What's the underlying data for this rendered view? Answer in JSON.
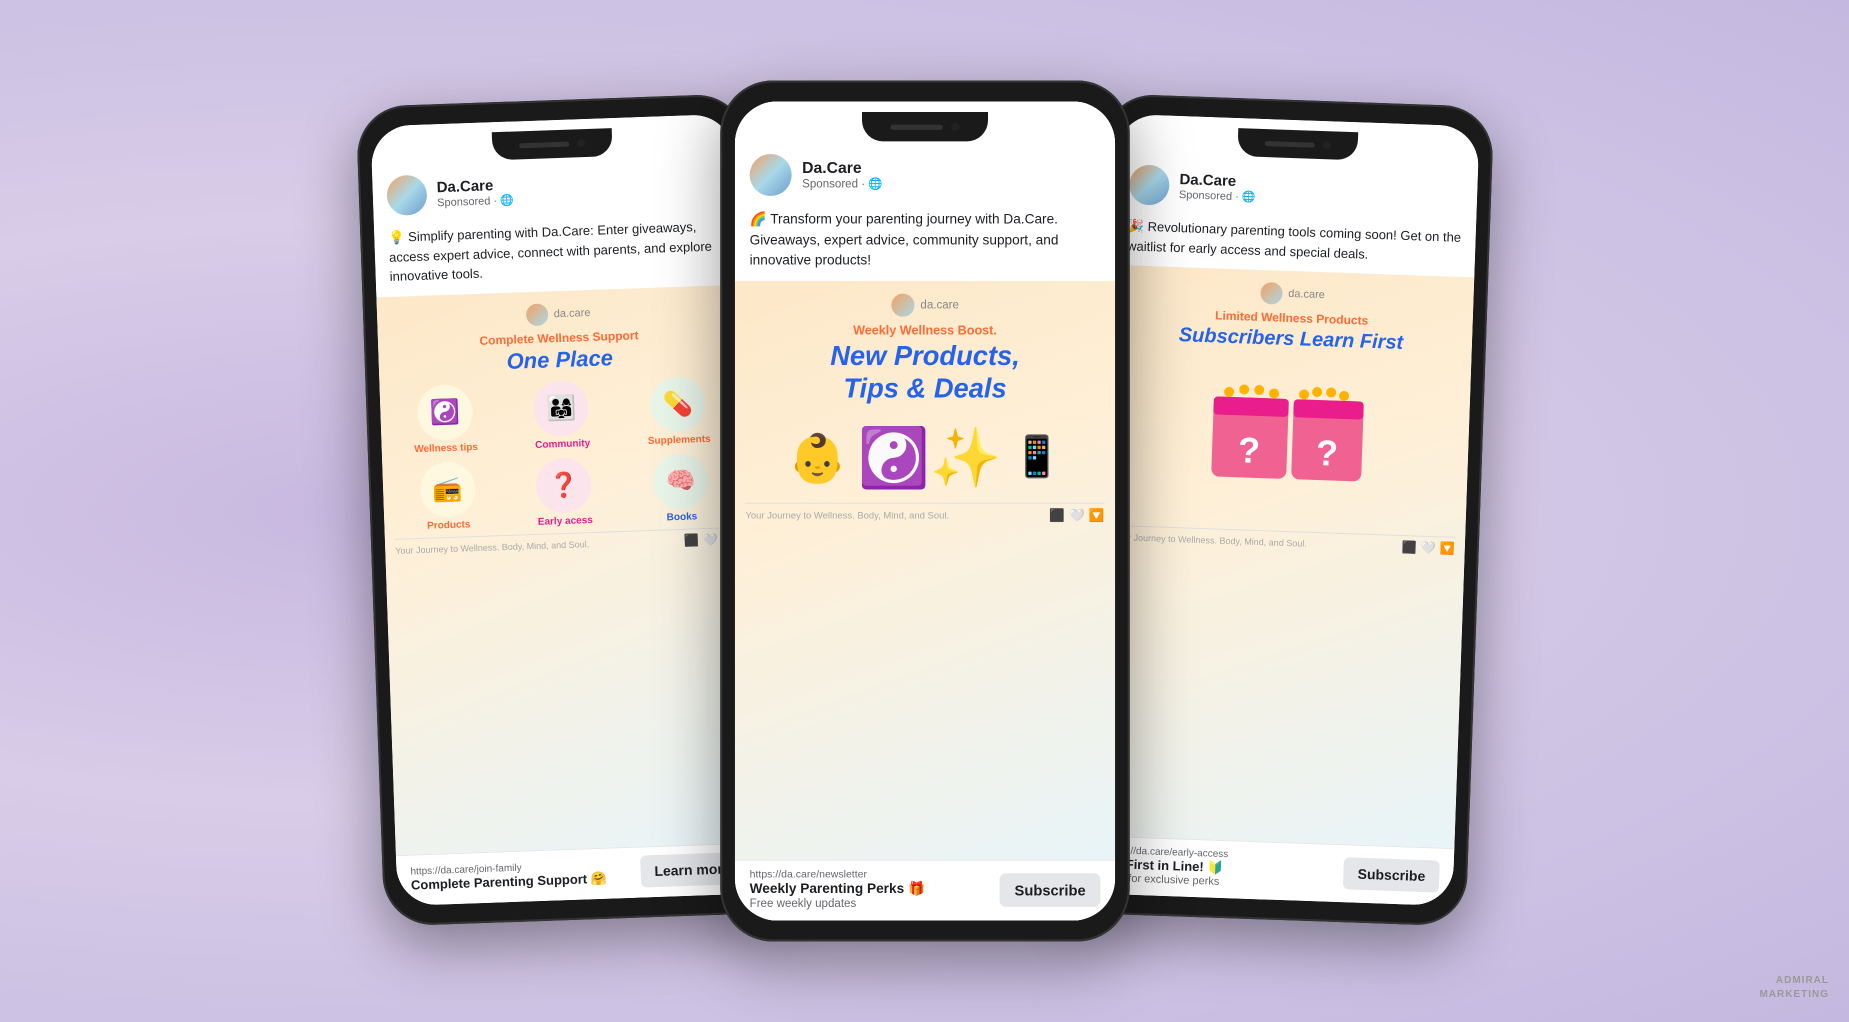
{
  "phones": [
    {
      "id": "left",
      "brand": "Da.Care",
      "sponsored": "Sponsored · 🌐",
      "ad_text": "💡 Simplify parenting with Da.Care: Enter giveaways, access expert advice, connect with parents, and explore innovative tools.",
      "creative": {
        "logo_text": "da.care",
        "subtitle": "Complete Wellness Support",
        "title": "One Place",
        "icons": [
          {
            "emoji": "☯️",
            "label": "Wellness tips",
            "color": "orange"
          },
          {
            "emoji": "👨‍👩‍👧",
            "label": "Community",
            "color": "pink"
          },
          {
            "emoji": "💊",
            "label": "Supplements",
            "color": "green"
          },
          {
            "emoji": "📻",
            "label": "Products",
            "color": "orange"
          },
          {
            "emoji": "❓",
            "label": "Early acess",
            "color": "pink"
          },
          {
            "emoji": "🧠",
            "label": "Books",
            "color": "blue"
          }
        ],
        "footer_text": "Your Journey to Wellness. Body, Mind, and Soul."
      },
      "cta": {
        "url": "https://da.care/join-family",
        "title": "Complete Parenting Support 🤗",
        "subtitle": "",
        "button": "Learn more"
      }
    },
    {
      "id": "center",
      "brand": "Da.Care",
      "sponsored": "Sponsored · 🌐",
      "ad_text": "🌈 Transform your parenting journey with Da.Care. Giveaways, expert advice, community support, and innovative products!",
      "creative": {
        "logo_text": "da.care",
        "subtitle": "Weekly Wellness Boost.",
        "title": "New Products,\nTips & Deals",
        "icons_type": "row",
        "icons": [
          {
            "emoji": "👶",
            "label": ""
          },
          {
            "emoji": "☯️✨",
            "label": ""
          },
          {
            "emoji": "📱",
            "label": ""
          }
        ],
        "footer_text": "Your Journey to Wellness. Body, Mind, and Soul."
      },
      "cta": {
        "url": "https://da.care/newsletter",
        "title": "Weekly Parenting Perks 🎁",
        "subtitle": "Free weekly updates",
        "button": "Subscribe"
      }
    },
    {
      "id": "right",
      "brand": "Da.Care",
      "sponsored": "Sponsored · 🌐",
      "ad_text": "🎉 Revolutionary parenting tools coming soon! Get on the waitlist for early access and special deals.",
      "creative": {
        "logo_text": "da.care",
        "subtitle": "Limited Wellness Products",
        "title": "Subscribers Learn First",
        "icons_type": "mystery",
        "footer_text": "Your Journey to Wellness. Body, Mind, and Soul."
      },
      "cta": {
        "url": "https://da.care/early-access",
        "title": "Be First in Line! 🔰",
        "subtitle": "Join for exclusive perks",
        "button": "Subscribe"
      }
    }
  ],
  "watermark": {
    "line1": "ADMIRAL",
    "line2": "MARKETING"
  }
}
